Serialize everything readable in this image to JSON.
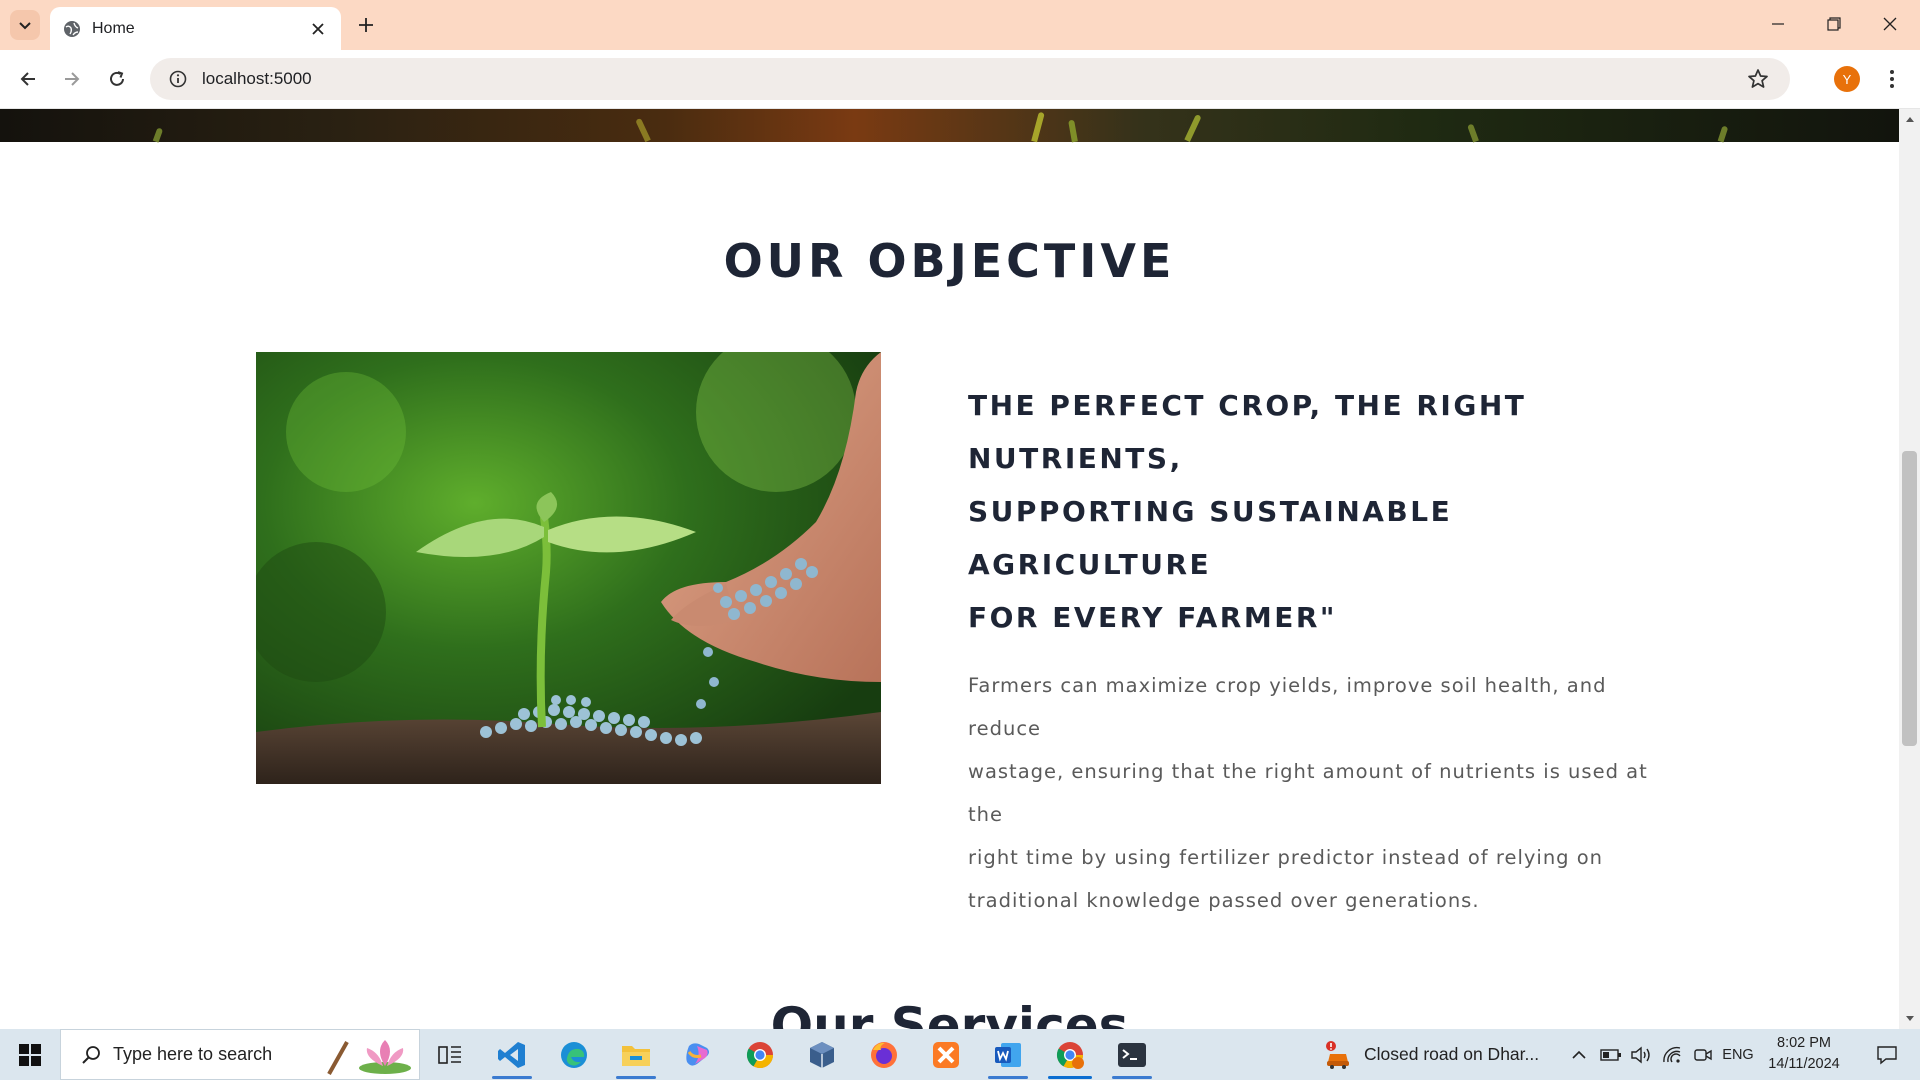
{
  "browser": {
    "tab_title": "Home",
    "url": "localhost:5000",
    "profile_initial": "Y"
  },
  "page": {
    "objective_title": "OUR OBJECTIVE",
    "objective_heading_lines": [
      "THE PERFECT CROP, THE RIGHT NUTRIENTS,",
      "SUPPORTING SUSTAINABLE AGRICULTURE",
      "FOR EVERY FARMER\""
    ],
    "objective_body_lines": [
      "Farmers can maximize crop yields, improve soil health, and reduce",
      "wastage, ensuring that the right amount of nutrients is used at the",
      "right time by using fertilizer predictor instead of relying on",
      "traditional knowledge passed over generations."
    ],
    "services_title": "Our Services"
  },
  "taskbar": {
    "search_placeholder": "Type here to search",
    "news_text": "Closed road on Dhar...",
    "language": "ENG",
    "time": "8:02 PM",
    "date": "14/11/2024",
    "pinned_apps": [
      "task-view",
      "vs-code",
      "edge",
      "file-explorer",
      "copilot",
      "chrome",
      "virtualbox",
      "firefox",
      "xampp",
      "word",
      "chrome-profile",
      "terminal"
    ]
  },
  "colors": {
    "tabstrip": "#fcd9c4",
    "heading": "#1e2535",
    "body_text": "#5a5a5a",
    "taskbar": "#dbe6ee"
  }
}
